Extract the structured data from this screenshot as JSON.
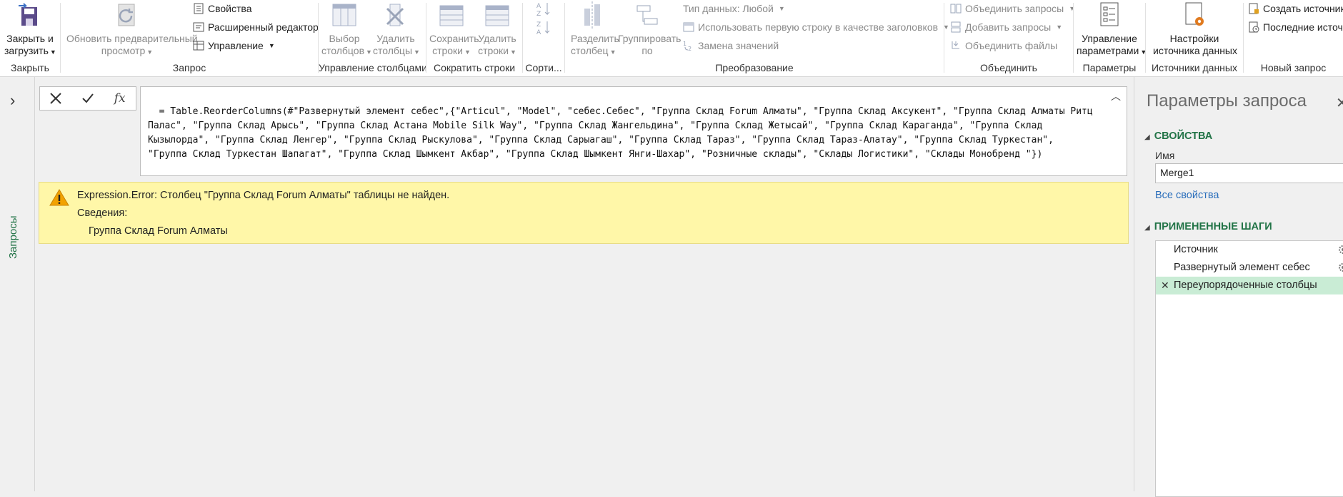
{
  "ribbon": {
    "groups": {
      "close": "Закрыть",
      "query": "Запрос",
      "manage_columns": "Управление столбцами",
      "reduce_rows": "Сократить строки",
      "sort": "Сорти...",
      "transform": "Преобразование",
      "combine": "Объединить",
      "parameters": "Параметры",
      "data_sources": "Источники данных",
      "new_query": "Новый запрос"
    },
    "close_load": [
      "Закрыть и",
      "загрузить"
    ],
    "refresh_preview": [
      "Обновить предварительный",
      "просмотр"
    ],
    "properties": "Свойства",
    "advanced_editor": "Расширенный редактор",
    "manage": "Управление",
    "choose_columns": [
      "Выбор",
      "столбцов"
    ],
    "remove_columns": [
      "Удалить",
      "столбцы"
    ],
    "keep_rows": [
      "Сохранить",
      "строки"
    ],
    "remove_rows": [
      "Удалить",
      "строки"
    ],
    "split_column": [
      "Разделить",
      "столбец"
    ],
    "group_by": [
      "Группировать",
      "по"
    ],
    "data_type": "Тип данных: Любой",
    "use_first_row": "Использовать первую строку в качестве заголовков",
    "replace_values": "Замена значений",
    "merge_queries": "Объединить запросы",
    "append_queries": "Добавить запросы",
    "combine_files": "Объединить файлы",
    "manage_params": [
      "Управление",
      "параметрами"
    ],
    "source_settings": [
      "Настройки",
      "источника данных"
    ],
    "new_source": "Создать источник",
    "recent_sources": "Последние источни"
  },
  "nav": {
    "queries_label": "Запросы"
  },
  "formula": {
    "text": "= Table.ReorderColumns(#\"Развернутый элемент себес\",{\"Articul\", \"Model\", \"себес.Себес\", \"Группа Склад Forum Алматы\", \"Группа Склад Аксукент\", \"Группа Склад Алматы Ритц Палас\", \"Группа Склад Арысь\", \"Группа Склад Астана Mobile Silk Way\", \"Группа Склад Жангельдина\", \"Группа Склад Жетысай\", \"Группа Склад Караганда\", \"Группа Склад Кызылорда\", \"Группа Склад Ленгер\", \"Группа Склад Рыскулова\", \"Группа Склад Сарыагаш\", \"Группа Склад Тараз\", \"Группа Склад Тараз-Алатау\", \"Группа Склад Туркестан\", \"Группа Склад Туркестан Шапагат\", \"Группа Склад Шымкент Акбар\", \"Группа Склад Шымкент Янги-Шахар\", \"Розничные склады\", \"Склады Логистики\", \"Склады Монобренд \"})",
    "fx": "fx"
  },
  "error": {
    "message": "Expression.Error: Столбец \"Группа Склад Forum Алматы\" таблицы не найден.",
    "details_label": "Сведения:",
    "details_value": "Группа Склад Forum Алматы"
  },
  "panel": {
    "title": "Параметры запроса",
    "properties_head": "СВОЙСТВА",
    "name_label": "Имя",
    "name_value": "Merge1",
    "all_properties": "Все свойства",
    "steps_head": "ПРИМЕНЕННЫЕ ШАГИ",
    "steps": [
      "Источник",
      "Развернутый элемент себес",
      "Переупорядоченные столбцы"
    ]
  },
  "colors": {
    "accent_green": "#217346",
    "error_bg": "#fff7a8",
    "active_step": "#c9ecd5",
    "link_blue": "#2a6ebb"
  }
}
